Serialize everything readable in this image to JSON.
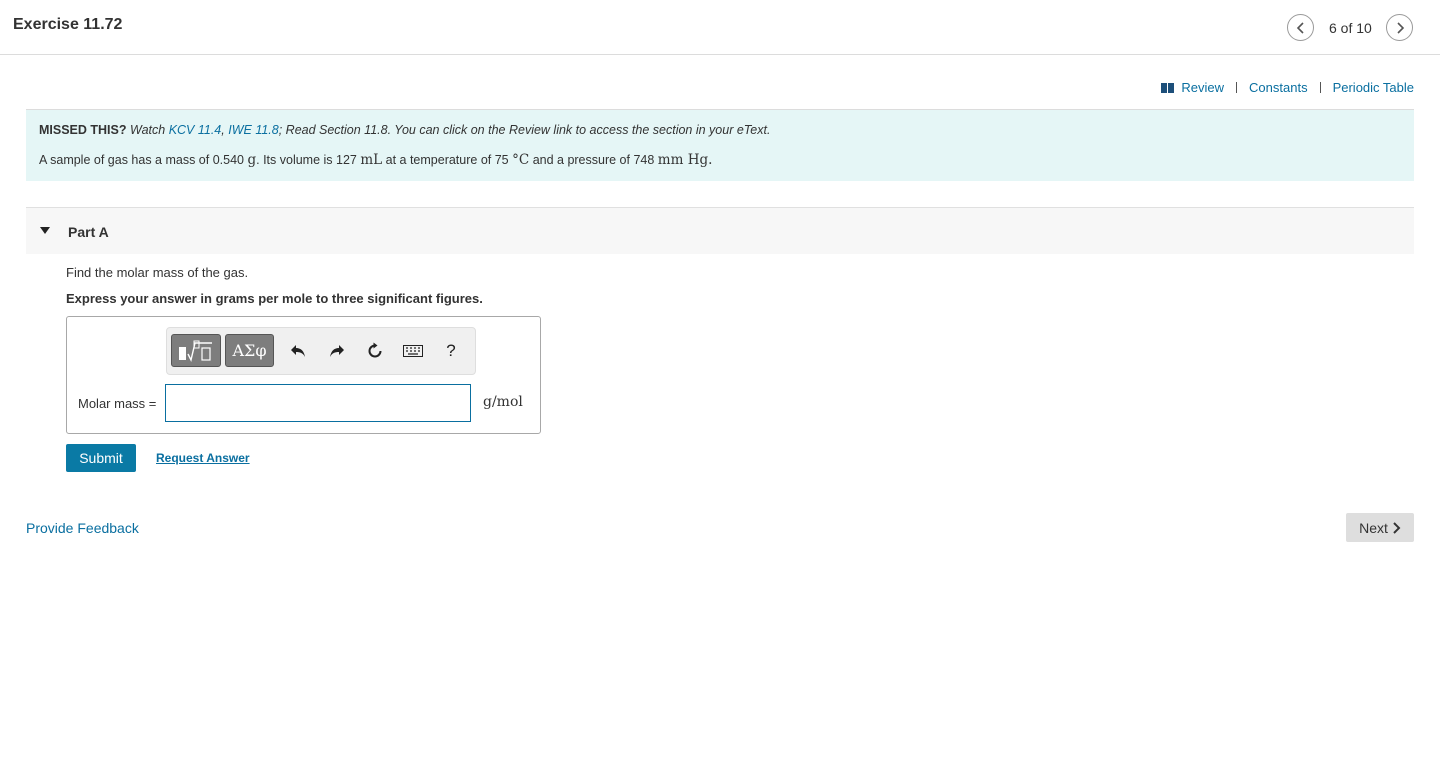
{
  "header": {
    "title": "Exercise 11.72",
    "position": "6 of 10",
    "prev_icon": "chevron-left-icon",
    "next_icon": "chevron-right-icon"
  },
  "resources": {
    "review": "Review",
    "constants": "Constants",
    "periodic_table": "Periodic Table"
  },
  "missed": {
    "label": "MISSED THIS?",
    "watch": "Watch",
    "kcv": "KCV 11.4",
    "comma": ",",
    "iwe": "IWE 11.8",
    "rest": "; Read Section 11.8. You can click on the Review link to access the section in your eText."
  },
  "problem": {
    "t1": "A sample of gas has a mass of 0.540",
    "m1": "g",
    "t2": ". Its volume is 127",
    "m2": "mL",
    "t3": "at a temperature of 75",
    "m3": "°C",
    "t4": "and a pressure of 748",
    "m4": "mm Hg",
    "t5": "."
  },
  "part": {
    "title": "Part A",
    "question": "Find the molar mass of the gas.",
    "instruction": "Express your answer in grams per mole to three significant figures."
  },
  "toolbar": {
    "greek": "ΑΣφ",
    "help": "?"
  },
  "answer": {
    "label": "Molar mass =",
    "value": "",
    "unit": "g/mol"
  },
  "actions": {
    "submit": "Submit",
    "request": "Request Answer",
    "feedback": "Provide Feedback",
    "next": "Next"
  },
  "colors": {
    "link": "#0a6fa0",
    "submit_bg": "#0a7aa5",
    "missed_bg": "#e5f6f6"
  }
}
